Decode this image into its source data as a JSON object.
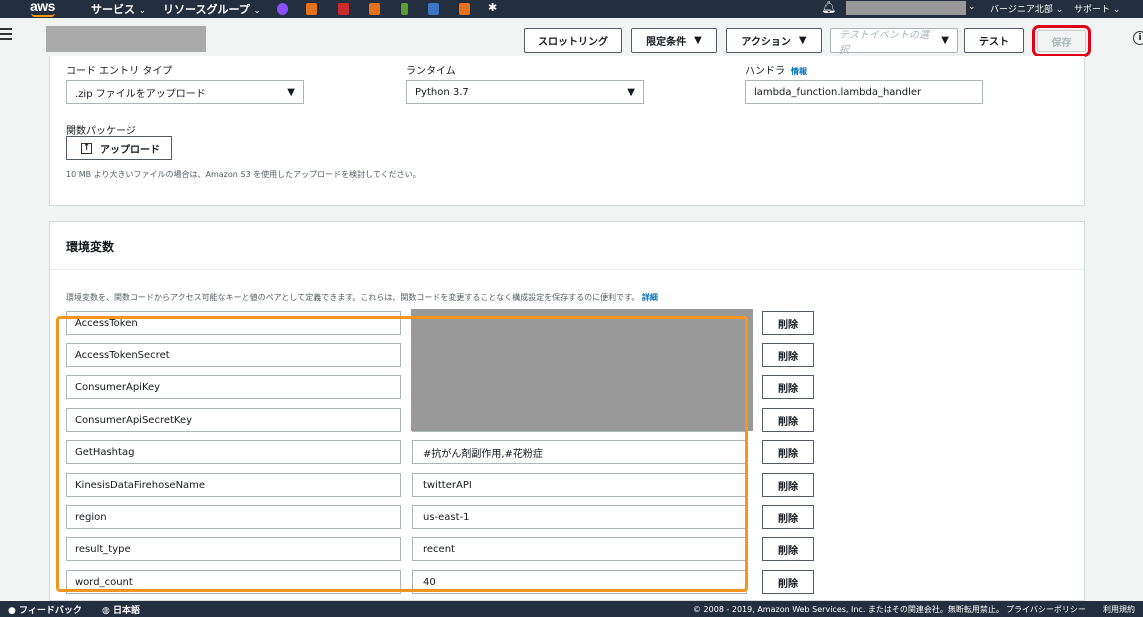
{
  "topnav": {
    "logo": "aws",
    "services": "サービス",
    "resource_groups": "リソースグループ",
    "region": "バージニア北部",
    "support": "サポート",
    "service_icons": [
      {
        "name": "service-icon-1",
        "color": "#8c4fff"
      },
      {
        "name": "service-icon-2",
        "color": "#e7711b"
      },
      {
        "name": "service-icon-3",
        "color": "#cc2a2a"
      },
      {
        "name": "service-icon-4",
        "color": "#e7711b"
      },
      {
        "name": "service-icon-5",
        "color": "#5a9e2f"
      },
      {
        "name": "service-icon-6",
        "color": "#3b75c4"
      },
      {
        "name": "service-icon-7",
        "color": "#e7711b"
      }
    ]
  },
  "header": {
    "slot_ring": "スロットリング",
    "qualifiers": "限定条件",
    "actions": "アクション",
    "test_event_placeholder": "テストイベントの選択",
    "test": "テスト",
    "save": "保存"
  },
  "code": {
    "entry_type_label": "コード エントリ タイプ",
    "entry_type_value": ".zip ファイルをアップロード",
    "runtime_label": "ランタイム",
    "runtime_value": "Python 3.7",
    "handler_label": "ハンドラ",
    "handler_info": "情報",
    "handler_value": "lambda_function.lambda_handler",
    "package_label": "関数パッケージ",
    "upload_label": "アップロード",
    "upload_hint": "10 MB より大きいファイルの場合は、Amazon S3 を使用したアップロードを検討してください。"
  },
  "env": {
    "title": "環境変数",
    "description": "環境変数を、関数コードからアクセス可能なキーと値のペアとして定義できます。これらは、関数コードを変更することなく構成設定を保存するのに便利です。",
    "detail_link": "詳細",
    "delete_label": "削除",
    "rows": [
      {
        "key": "AccessToken",
        "value": ""
      },
      {
        "key": "AccessTokenSecret",
        "value": ""
      },
      {
        "key": "ConsumerApiKey",
        "value": ""
      },
      {
        "key": "ConsumerApiSecretKey",
        "value": ""
      },
      {
        "key": "GetHashtag",
        "value": "#抗がん剤副作用,#花粉症"
      },
      {
        "key": "KinesisDataFirehoseName",
        "value": "twitterAPI"
      },
      {
        "key": "region",
        "value": "us-east-1"
      },
      {
        "key": "result_type",
        "value": "recent"
      },
      {
        "key": "word_count",
        "value": "40"
      }
    ]
  },
  "footer": {
    "feedback": "フィードバック",
    "language": "日本語",
    "copyright": "© 2008 - 2019, Amazon Web Services, Inc. またはその関連会社。無断転用禁止。",
    "privacy": "プライバシーポリシー",
    "terms": "利用規約"
  }
}
